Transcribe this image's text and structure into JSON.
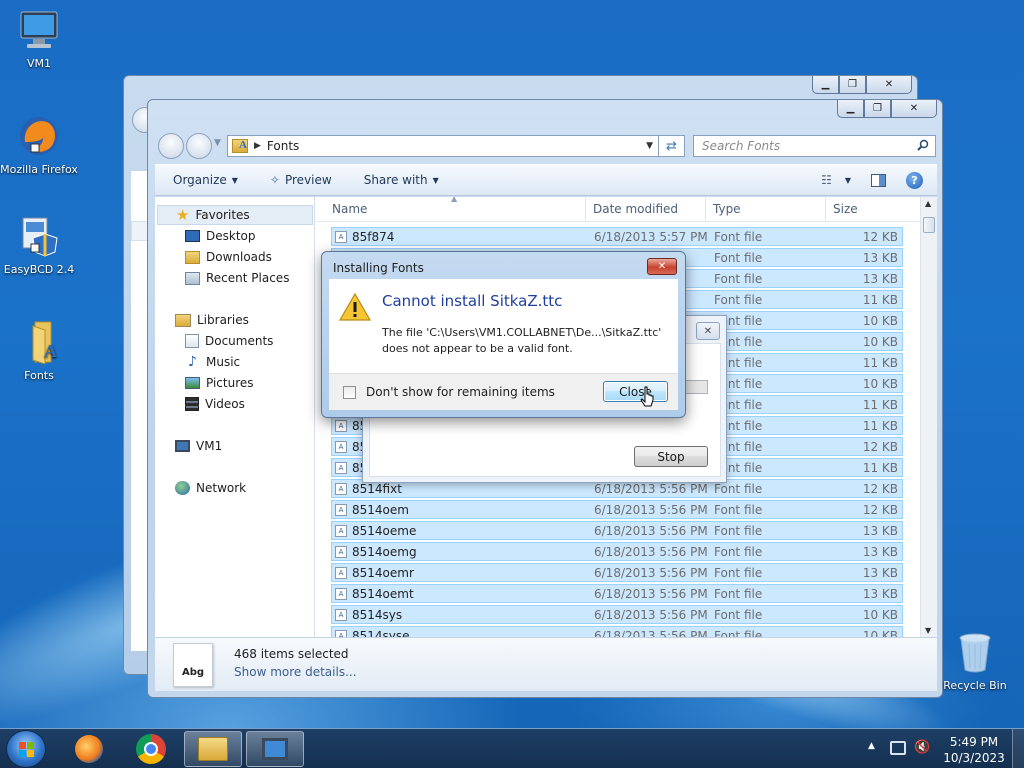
{
  "desktop": {
    "icons": [
      {
        "label": "VM1"
      },
      {
        "label": "Mozilla Firefox"
      },
      {
        "label": "EasyBCD 2.4"
      },
      {
        "label": "Fonts"
      },
      {
        "label": "Recycle Bin"
      }
    ]
  },
  "explorer": {
    "breadcrumb": "Fonts",
    "search_placeholder": "Search Fonts",
    "toolbar": {
      "organize": "Organize",
      "preview": "Preview",
      "share_with": "Share with"
    },
    "nav": {
      "favorites": "Favorites",
      "desktop": "Desktop",
      "downloads": "Downloads",
      "recent_places": "Recent Places",
      "libraries": "Libraries",
      "documents": "Documents",
      "music": "Music",
      "pictures": "Pictures",
      "videos": "Videos",
      "computer": "VM1",
      "network": "Network"
    },
    "columns": {
      "name": "Name",
      "date": "Date modified",
      "type": "Type",
      "size": "Size"
    },
    "rows": [
      {
        "name": "85f874",
        "date": "6/18/2013 5:57 PM",
        "type": "Font file",
        "size": "12 KB"
      },
      {
        "name": "",
        "date": "",
        "type": "Font file",
        "size": "13 KB"
      },
      {
        "name": "",
        "date": "",
        "type": "Font file",
        "size": "13 KB"
      },
      {
        "name": "",
        "date": "",
        "type": "Font file",
        "size": "11 KB"
      },
      {
        "name": "",
        "date": "",
        "type": "Font file",
        "size": "10 KB"
      },
      {
        "name": "",
        "date": "",
        "type": "Font file",
        "size": "10 KB"
      },
      {
        "name": "",
        "date": "",
        "type": "Font file",
        "size": "11 KB"
      },
      {
        "name": "",
        "date": "",
        "type": "Font file",
        "size": "10 KB"
      },
      {
        "name": "",
        "date": "",
        "type": "Font file",
        "size": "11 KB"
      },
      {
        "name": "85",
        "date": "",
        "type": "Font file",
        "size": "11 KB"
      },
      {
        "name": "85",
        "date": "",
        "type": "Font file",
        "size": "12 KB"
      },
      {
        "name": "85",
        "date": "",
        "type": "Font file",
        "size": "11 KB"
      },
      {
        "name": "8514fixt",
        "date": "6/18/2013 5:56 PM",
        "type": "Font file",
        "size": "12 KB"
      },
      {
        "name": "8514oem",
        "date": "6/18/2013 5:56 PM",
        "type": "Font file",
        "size": "12 KB"
      },
      {
        "name": "8514oeme",
        "date": "6/18/2013 5:56 PM",
        "type": "Font file",
        "size": "13 KB"
      },
      {
        "name": "8514oemg",
        "date": "6/18/2013 5:56 PM",
        "type": "Font file",
        "size": "13 KB"
      },
      {
        "name": "8514oemr",
        "date": "6/18/2013 5:56 PM",
        "type": "Font file",
        "size": "13 KB"
      },
      {
        "name": "8514oemt",
        "date": "6/18/2013 5:56 PM",
        "type": "Font file",
        "size": "13 KB"
      },
      {
        "name": "8514sys",
        "date": "6/18/2013 5:56 PM",
        "type": "Font file",
        "size": "10 KB"
      },
      {
        "name": "8514syse",
        "date": "6/18/2013 5:56 PM",
        "type": "Font file",
        "size": "10 KB"
      }
    ],
    "details": {
      "thumb_text": "Abg",
      "count": "468 items selected",
      "more": "Show more details..."
    }
  },
  "progress_dialog": {
    "stop": "Stop"
  },
  "dialog": {
    "title": "Installing Fonts",
    "heading": "Cannot install SitkaZ.ttc",
    "message_line1": "The file 'C:\\Users\\VM1.COLLABNET\\De...\\SitkaZ.ttc'",
    "message_line2": "does not appear to be a valid font.",
    "checkbox_label": "Don't show for remaining items",
    "close": "Close"
  },
  "taskbar": {
    "time": "5:49 PM",
    "date": "10/3/2023"
  },
  "colors": {
    "selection": "#cce8ff",
    "close_red": "#c9503d",
    "heading_blue": "#1e3fa0"
  }
}
